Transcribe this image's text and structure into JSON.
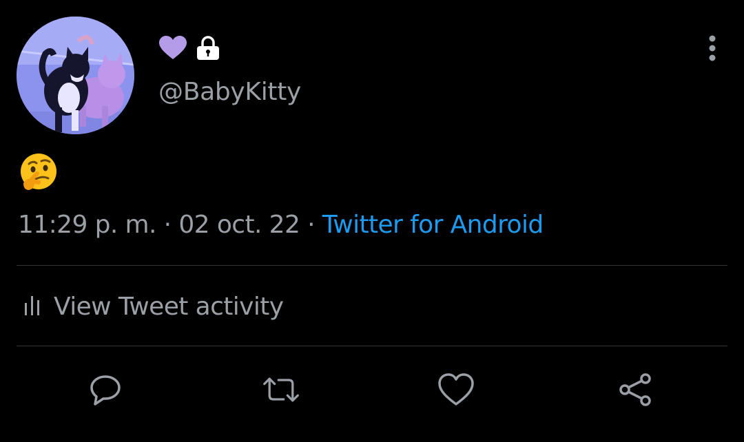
{
  "tweet": {
    "display_name_badges": [
      "heart-badge-icon",
      "lock-icon"
    ],
    "handle": "@BabyKitty",
    "text_emoji": "thinking-face-emoji",
    "time": "11:29 p. m.",
    "separator": " · ",
    "date": "02 oct. 22",
    "source": "Twitter for Android",
    "activity_label": "View Tweet activity"
  },
  "colors": {
    "background": "#000000",
    "secondary_text": "#9aa0a6",
    "link": "#1d9bf0",
    "badge_purple": "#b49ce8",
    "divider": "#2f3336"
  },
  "actions": [
    "reply-icon",
    "retweet-icon",
    "like-icon",
    "share-icon"
  ]
}
